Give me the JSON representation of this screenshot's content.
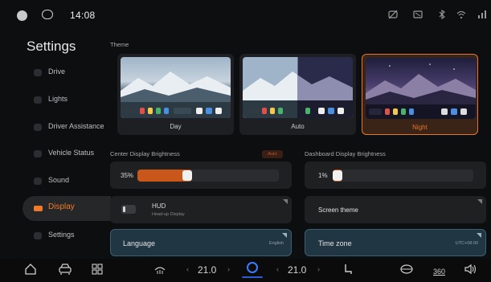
{
  "status_bar": {
    "time": "14:08",
    "icons": [
      "avatar-icon",
      "message-icon",
      "camera-off-icon",
      "screen-icon",
      "bluetooth-icon",
      "wifi-icon",
      "network-icon"
    ]
  },
  "sidebar": {
    "title": "Settings",
    "items": [
      {
        "label": "Drive",
        "icon": "steering-icon",
        "active": false
      },
      {
        "label": "Lights",
        "icon": "bulb-icon",
        "active": false
      },
      {
        "label": "Driver Assistance",
        "icon": "assist-icon",
        "active": false
      },
      {
        "label": "Vehicle Status",
        "icon": "car-status-icon",
        "active": false
      },
      {
        "label": "Sound",
        "icon": "speaker-icon",
        "active": false
      },
      {
        "label": "Display",
        "icon": "display-icon",
        "active": true
      },
      {
        "label": "Settings",
        "icon": "gear-icon",
        "active": false
      }
    ]
  },
  "theme": {
    "label": "Theme",
    "options": [
      {
        "label": "Day",
        "selected": false
      },
      {
        "label": "Auto",
        "selected": false
      },
      {
        "label": "Night",
        "selected": true
      }
    ]
  },
  "center_brightness": {
    "label": "Center Display Brightness",
    "badge": "Auto",
    "value_text": "35%",
    "level": 0.35
  },
  "dashboard_brightness": {
    "label": "Dashboard Display Brightness",
    "value_text": "1%",
    "level": 0.01
  },
  "hud": {
    "title": "HUD",
    "subtitle": "Head-up Display",
    "enabled": false
  },
  "screen_theme": {
    "title": "Screen theme"
  },
  "language": {
    "title": "Language",
    "value": "English"
  },
  "time_zone": {
    "title": "Time zone",
    "value": "UTC+08:00"
  },
  "dock": {
    "left_temp": "21.0",
    "right_temp": "21.0",
    "camera_label": "360",
    "accent": "#3b7cff"
  },
  "colors": {
    "accent_orange": "#f07a2a",
    "card_bg": "#1f2022",
    "blue_card": "#203642"
  }
}
